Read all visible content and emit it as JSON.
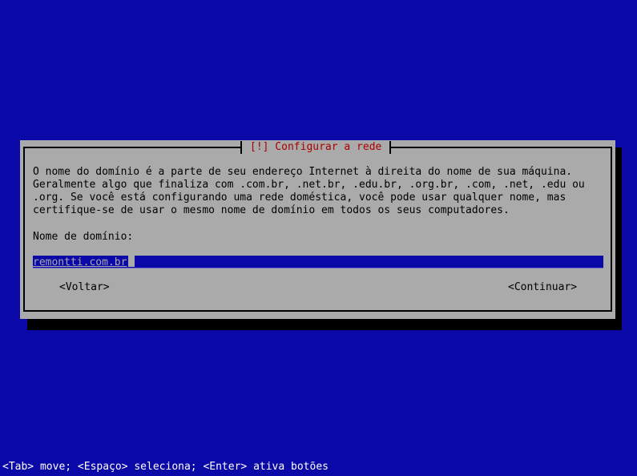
{
  "dialog": {
    "title": "[!] Configurar a rede",
    "description": "O nome do domínio é a parte de seu endereço Internet à direita do nome de sua máquina.\nGeralmente algo que finaliza com .com.br, .net.br, .edu.br, .org.br, .com, .net, .edu ou\n.org. Se você está configurando uma rede doméstica, você pode usar qualquer nome, mas\ncertifique-se de usar o mesmo nome de domínio em todos os seus computadores.",
    "field_label": "Nome de domínio:",
    "field_value": "remontti.com.br",
    "back_button": "<Voltar>",
    "continue_button": "<Continuar>"
  },
  "statusbar": {
    "text": "<Tab> move; <Espaço> seleciona; <Enter> ativa botões"
  },
  "colors": {
    "background": "#0b08a8",
    "dialog": "#aaaaaa",
    "title": "#aa0000",
    "shadow": "#000000"
  }
}
